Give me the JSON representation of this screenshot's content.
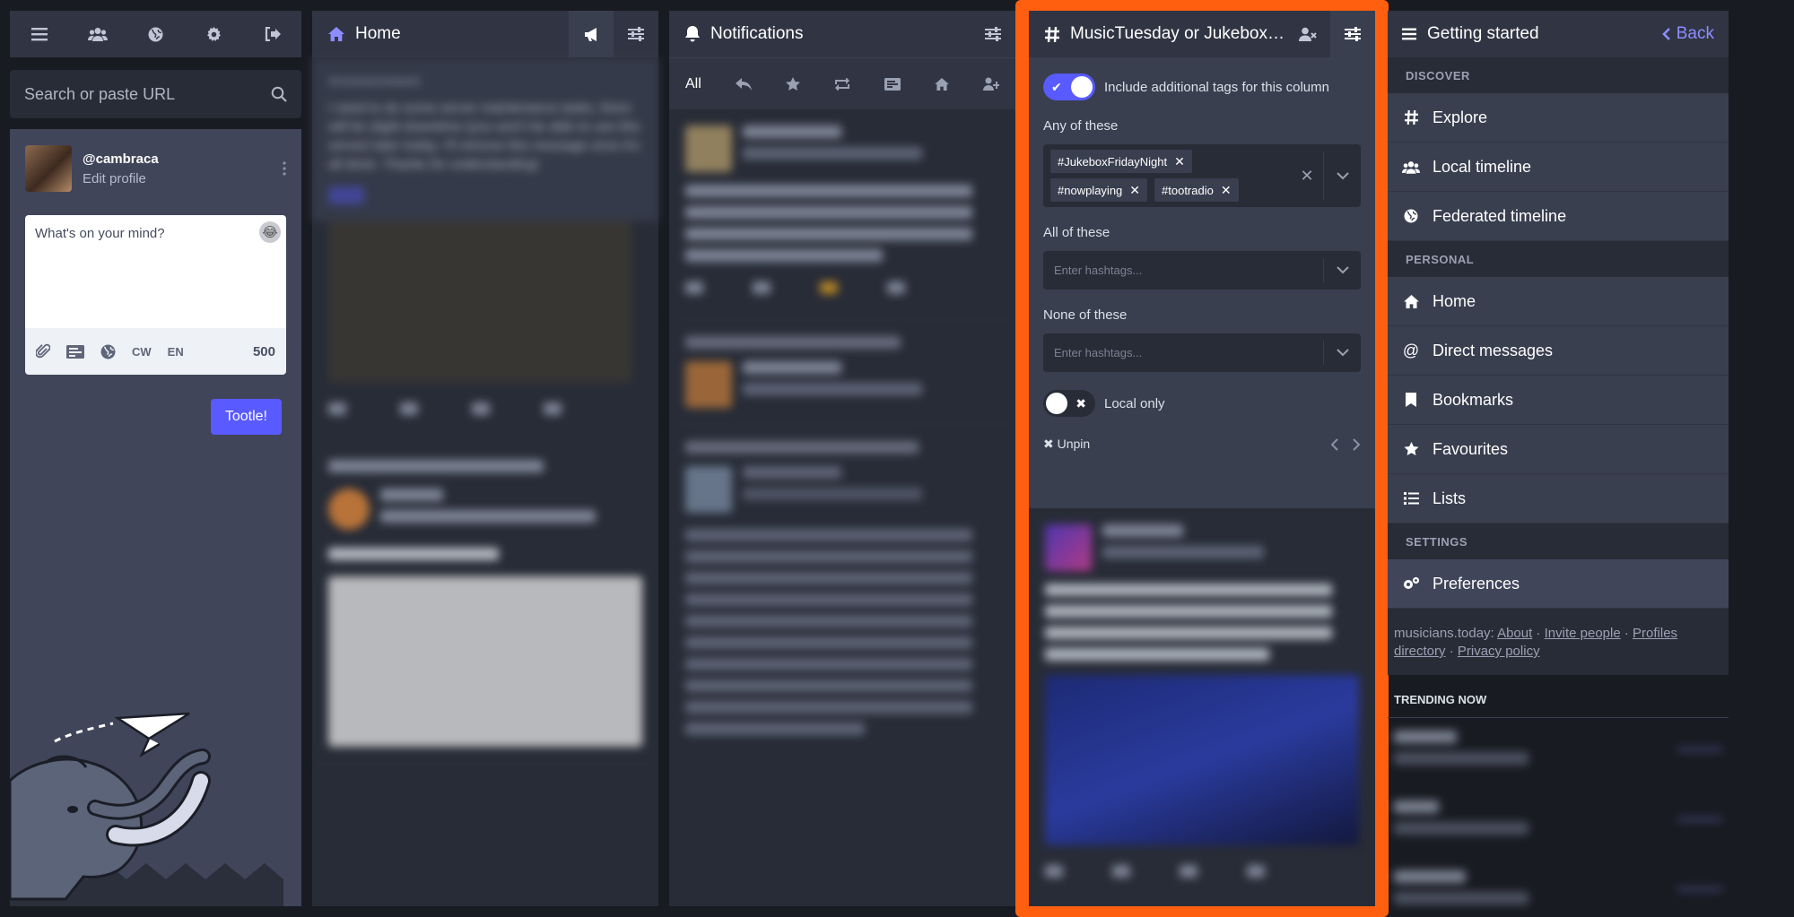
{
  "compose": {
    "search_placeholder": "Search or paste URL",
    "handle": "@cambraca",
    "edit_profile": "Edit profile",
    "placeholder": "What's on your mind?",
    "cw": "CW",
    "lang": "EN",
    "counter": "500",
    "submit": "Tootle!"
  },
  "home": {
    "title": "Home",
    "announcement_label": "Announcement",
    "announcement_text": "I need to do some server maintenance tasks, there will be slight downtime (you won't be able to use this server) later today. I'll remove this message once it's all done. Thanks for understanding!"
  },
  "notifications": {
    "title": "Notifications",
    "tab_all": "All"
  },
  "hashtag": {
    "title": "MusicTuesday or Jukebox…",
    "include_tags": "Include additional tags for this column",
    "any_label": "Any of these",
    "any_tags": [
      "#JukeboxFridayNight",
      "#nowplaying",
      "#tootradio"
    ],
    "all_label": "All of these",
    "none_label": "None of these",
    "input_placeholder": "Enter hashtags...",
    "local_only": "Local only",
    "unpin": "Unpin"
  },
  "getting_started": {
    "title": "Getting started",
    "back": "Back",
    "sections": {
      "discover": "DISCOVER",
      "personal": "PERSONAL",
      "settings": "SETTINGS"
    },
    "items": {
      "explore": "Explore",
      "local": "Local timeline",
      "federated": "Federated timeline",
      "home": "Home",
      "dm": "Direct messages",
      "bookmarks": "Bookmarks",
      "favourites": "Favourites",
      "lists": "Lists",
      "preferences": "Preferences"
    },
    "footer": {
      "domain": "musicians.today:",
      "about": "About",
      "invite": "Invite people",
      "profiles": "Profiles directory",
      "privacy": "Privacy policy"
    },
    "trending_title": "TRENDING NOW"
  },
  "colors": {
    "accent": "#595aff",
    "highlight_frame": "#ff5f0f",
    "background": "#191b22"
  }
}
